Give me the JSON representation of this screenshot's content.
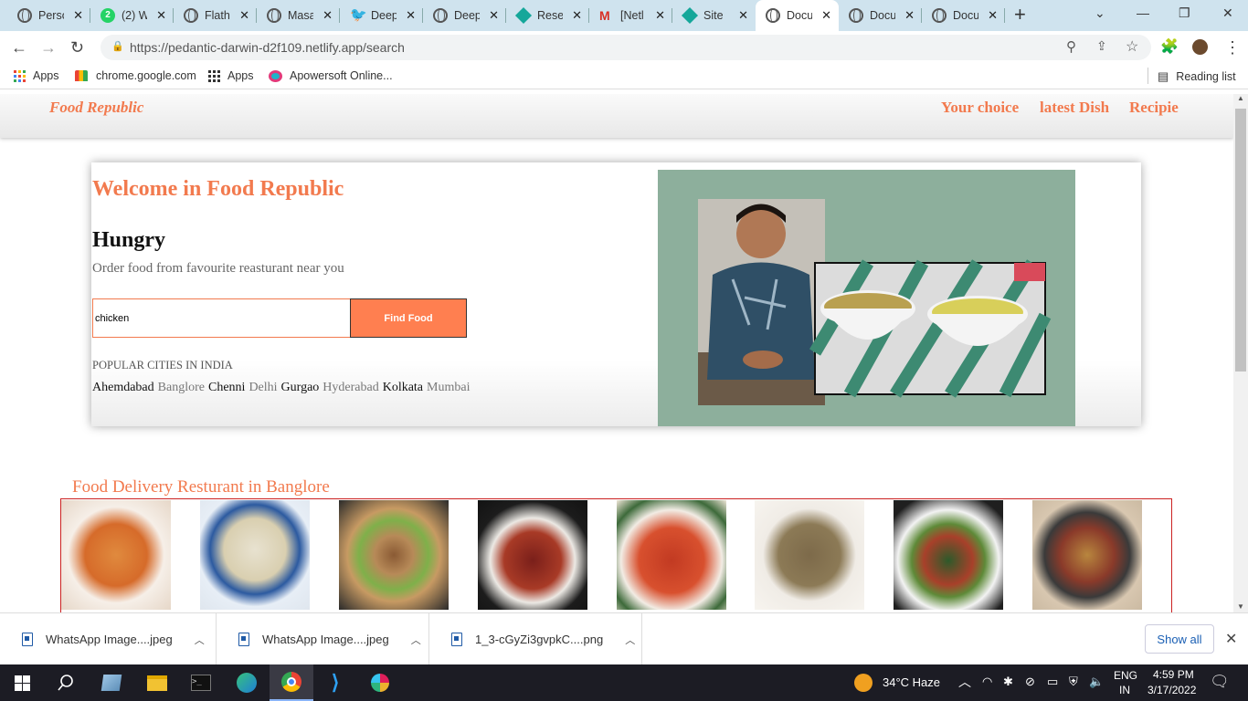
{
  "browser": {
    "tabs": [
      {
        "title": "Perso",
        "favicon": "globe-icon",
        "active": false
      },
      {
        "title": "(2) W",
        "favicon": "whatsapp-icon",
        "active": false
      },
      {
        "title": "Flath",
        "favicon": "globe-icon",
        "active": false
      },
      {
        "title": "Masa",
        "favicon": "globe-icon",
        "active": false
      },
      {
        "title": "Deep",
        "favicon": "twitter-icon",
        "active": false
      },
      {
        "title": "Deep",
        "favicon": "globe-icon",
        "active": false
      },
      {
        "title": "Reset",
        "favicon": "netlify-icon",
        "active": false
      },
      {
        "title": "[Netl",
        "favicon": "gmail-icon",
        "active": false
      },
      {
        "title": "Site",
        "favicon": "netlify-icon",
        "active": false
      },
      {
        "title": "Docu",
        "favicon": "globe-icon",
        "active": true
      },
      {
        "title": "Docu",
        "favicon": "globe-icon",
        "active": false
      },
      {
        "title": "Docu",
        "favicon": "globe-icon",
        "active": false
      }
    ],
    "url": "https://pedantic-darwin-d2f109.netlify.app/search",
    "bookmarks": [
      {
        "label": "Apps",
        "icon": "apps-grid-icon"
      },
      {
        "label": "chrome.google.com",
        "icon": "chrome-store-icon"
      },
      {
        "label": "Apps",
        "icon": "apps-grid-icon"
      },
      {
        "label": "Apowersoft Online...",
        "icon": "apowersoft-icon"
      }
    ],
    "reading_list": "Reading list"
  },
  "site": {
    "brand": "Food Republic",
    "nav": [
      "Your choice",
      "latest Dish",
      "Recipie"
    ],
    "hero": {
      "welcome": "Welcome in Food Republic",
      "heading": "Hungry",
      "subtitle": "Order food from favourite reasturant near you",
      "search_value": "chicken",
      "button": "Find Food",
      "popular_label": "POPULAR CITIES IN INDIA",
      "cities": [
        "Ahemdabad",
        "Banglore",
        "Chenni",
        "Delhi",
        "Gurgao",
        "Hyderabad",
        "Kolkata",
        "Mumbai"
      ]
    },
    "section_title": "Food Delivery Resturant in Banglore",
    "dishes_count": 8
  },
  "downloads": {
    "items": [
      "WhatsApp Image....jpeg",
      "WhatsApp Image....jpeg",
      "1_3-cGyZi3gvpkC....png"
    ],
    "show_all": "Show all"
  },
  "taskbar": {
    "weather": "34°C  Haze",
    "lang1": "ENG",
    "lang2": "IN",
    "time": "4:59 PM",
    "date": "3/17/2022"
  },
  "colors": {
    "accent": "#f27a4e",
    "button": "#ff7f50",
    "tabstrip": "#cfe3ee",
    "taskbar": "#1c1c24"
  }
}
